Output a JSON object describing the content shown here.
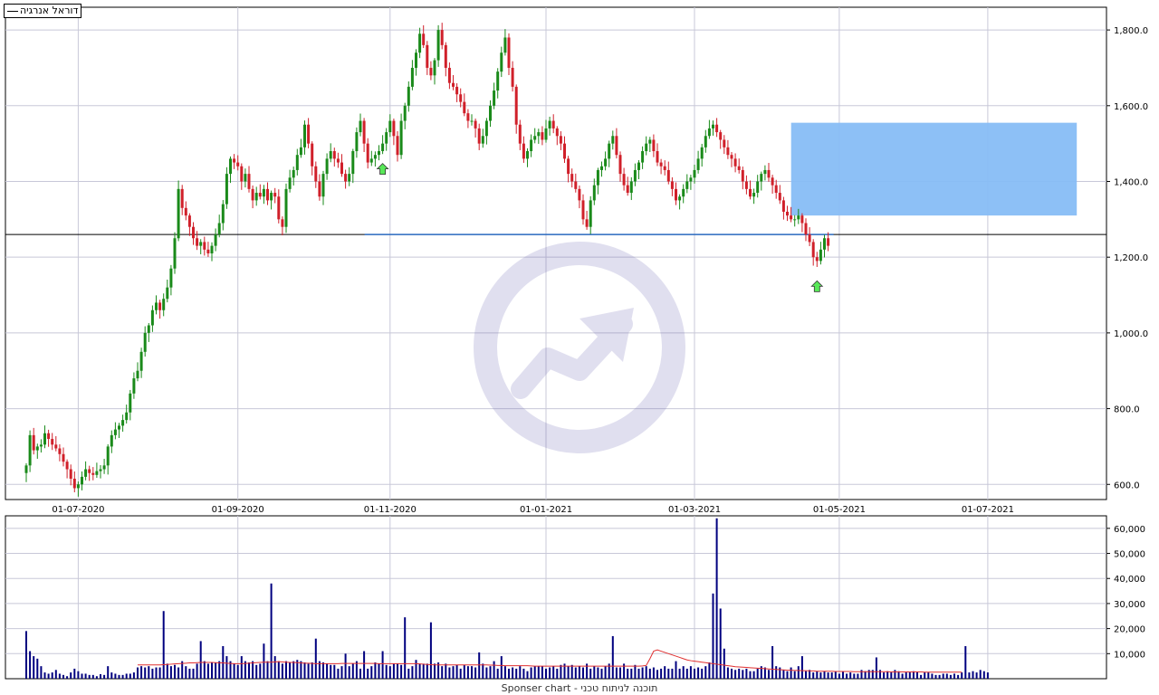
{
  "legend": {
    "label": "דוראל אנרגיה"
  },
  "footer": {
    "text": "Sponser chart - תוכנה לניתוח טכני"
  },
  "colors": {
    "up": "#1a8a1a",
    "down": "#d0202a",
    "zone": "#87bdf5",
    "support": "#2f6fc4",
    "volume": "#00007f",
    "volume_ma": "#e03030",
    "grid": "#c8c8d8"
  },
  "chart_data": [
    {
      "type": "candlestick",
      "ylim": [
        560,
        1860
      ],
      "yticks": [
        "600.0",
        "800.0",
        "1,000.0",
        "1,200.0",
        "1,400.0",
        "1,600.0",
        "1,800.0"
      ],
      "ytick_values": [
        600,
        800,
        1000,
        1200,
        1400,
        1600,
        1800
      ],
      "xticks": [
        "01-07-2020",
        "01-09-2020",
        "01-11-2020",
        "01-01-2021",
        "01-03-2021",
        "01-05-2021",
        "01-07-2021"
      ],
      "xtick_index": [
        14,
        57,
        98,
        140,
        180,
        219,
        259
      ],
      "close": [
        650,
        730,
        690,
        700,
        705,
        735,
        720,
        705,
        695,
        680,
        660,
        640,
        615,
        590,
        600,
        620,
        640,
        630,
        625,
        635,
        640,
        650,
        700,
        730,
        745,
        755,
        770,
        790,
        840,
        880,
        900,
        950,
        1000,
        1020,
        1060,
        1080,
        1060,
        1090,
        1120,
        1170,
        1250,
        1380,
        1330,
        1310,
        1280,
        1250,
        1230,
        1240,
        1220,
        1210,
        1230,
        1260,
        1290,
        1340,
        1420,
        1460,
        1450,
        1440,
        1400,
        1420,
        1380,
        1350,
        1370,
        1360,
        1380,
        1350,
        1370,
        1360,
        1300,
        1280,
        1380,
        1410,
        1430,
        1470,
        1490,
        1550,
        1500,
        1440,
        1400,
        1360,
        1420,
        1460,
        1480,
        1460,
        1450,
        1420,
        1400,
        1420,
        1480,
        1530,
        1560,
        1500,
        1450,
        1460,
        1470,
        1480,
        1500,
        1530,
        1560,
        1520,
        1470,
        1560,
        1600,
        1650,
        1700,
        1740,
        1790,
        1760,
        1700,
        1680,
        1720,
        1800,
        1760,
        1700,
        1660,
        1650,
        1630,
        1610,
        1580,
        1560,
        1560,
        1540,
        1500,
        1520,
        1560,
        1600,
        1640,
        1690,
        1740,
        1780,
        1700,
        1650,
        1550,
        1500,
        1460,
        1480,
        1510,
        1520,
        1530,
        1510,
        1540,
        1560,
        1540,
        1520,
        1500,
        1460,
        1420,
        1400,
        1380,
        1350,
        1300,
        1280,
        1350,
        1390,
        1430,
        1440,
        1460,
        1500,
        1520,
        1470,
        1420,
        1390,
        1370,
        1400,
        1430,
        1450,
        1480,
        1500,
        1510,
        1480,
        1450,
        1440,
        1430,
        1400,
        1380,
        1350,
        1360,
        1380,
        1400,
        1410,
        1430,
        1460,
        1490,
        1520,
        1540,
        1550,
        1530,
        1510,
        1490,
        1470,
        1460,
        1440,
        1430,
        1400,
        1380,
        1360,
        1370,
        1400,
        1420,
        1430,
        1410,
        1390,
        1370,
        1350,
        1320,
        1310,
        1300,
        1300,
        1310,
        1290,
        1260,
        1240,
        1200,
        1190,
        1220,
        1250,
        1230
      ],
      "volume_ylim": [
        0,
        65000
      ],
      "volume_yticks": [
        "10,000",
        "20,000",
        "30,000",
        "40,000",
        "50,000",
        "60,000"
      ],
      "volume_ytick_values": [
        10000,
        20000,
        30000,
        40000,
        50000,
        60000
      ],
      "volume": [
        19000,
        11000,
        9000,
        8000,
        5000,
        2500,
        2000,
        2500,
        3500,
        2000,
        1500,
        1000,
        2500,
        4000,
        3000,
        2000,
        2000,
        1500,
        1500,
        1000,
        1800,
        1500,
        5000,
        2500,
        2000,
        1500,
        1500,
        2000,
        2000,
        2500,
        4500,
        5000,
        4500,
        5000,
        4000,
        4500,
        4500,
        27000,
        6000,
        5000,
        5500,
        4500,
        7000,
        5000,
        4000,
        4000,
        6000,
        15000,
        7000,
        6000,
        6500,
        6500,
        7000,
        13000,
        9000,
        7000,
        6000,
        5500,
        9000,
        7000,
        6500,
        7000,
        5500,
        6000,
        14000,
        7000,
        38000,
        9000,
        7000,
        6000,
        7000,
        6500,
        7000,
        7500,
        7000,
        6500,
        6000,
        6500,
        16000,
        7000,
        6500,
        6000,
        5500,
        5500,
        4000,
        5000,
        10000,
        5000,
        6000,
        7000,
        4000,
        11000,
        4000,
        5000,
        6500,
        6000,
        11000,
        5500,
        5000,
        6000,
        6000,
        5500,
        24500,
        4000,
        5000,
        7500,
        6000,
        6000,
        6000,
        22500,
        6000,
        6500,
        5000,
        6000,
        4500,
        5000,
        5500,
        4000,
        5500,
        5000,
        5000,
        4500,
        10500,
        6000,
        4500,
        5000,
        7000,
        4000,
        9000,
        5000,
        4000,
        4500,
        4000,
        5000,
        4000,
        3000,
        4500,
        5000,
        5000,
        5000,
        4000,
        4500,
        5000,
        4000,
        5500,
        6000,
        5000,
        5500,
        4500,
        5000,
        4500,
        6000,
        4000,
        5000,
        4500,
        4000,
        5000,
        6000,
        17000,
        4500,
        4500,
        6000,
        4000,
        4000,
        5500,
        4000,
        4500,
        5000,
        4000,
        4500,
        3500,
        4000,
        5000,
        4000,
        4000,
        7000,
        4000,
        5000,
        4000,
        5000,
        4000,
        4500,
        4000,
        5000,
        6500,
        34000,
        64000,
        28000,
        12000,
        4500,
        4000,
        3500,
        4000,
        3500,
        4000,
        3000,
        3000,
        4000,
        5000,
        4500,
        3500,
        13000,
        5000,
        4500,
        3500,
        3000,
        4500,
        3000,
        5000,
        9000,
        3000,
        3500,
        2500,
        3000,
        2500,
        3000,
        2500,
        2500,
        3000,
        2000,
        3000,
        2000,
        2500,
        2000,
        2000,
        3500,
        3000,
        3500,
        3500,
        8500,
        3500,
        2500,
        3000,
        2500,
        3500,
        3000,
        2000,
        2500,
        2500,
        3000,
        2500,
        1500,
        2500,
        2500,
        2000,
        1500,
        1500,
        2000,
        2000,
        1500,
        2000,
        1500,
        2500,
        13000,
        2500,
        3000,
        2500,
        3500,
        3000,
        2500
      ],
      "volume_ma": [
        5500,
        5500,
        5500,
        5500,
        5500,
        5500,
        5500,
        5600,
        5700,
        5800,
        5900,
        6000,
        6100,
        6200,
        6300,
        6300,
        6400,
        6500,
        6500,
        6500,
        6500,
        6400,
        6300,
        6300,
        6200,
        6100,
        6000,
        6000,
        6000,
        6100,
        6200,
        6300,
        6400,
        6500,
        6600,
        6600,
        6600,
        6700,
        6800,
        6700,
        6600,
        6500,
        6500,
        6400,
        6300,
        6200,
        6200,
        6100,
        6000,
        6000,
        6000,
        6000,
        6000,
        6000,
        6000,
        6100,
        6100,
        6100,
        6100,
        6100,
        6100,
        6100,
        6100,
        6100,
        6100,
        6000,
        6000,
        6000,
        6000,
        6000,
        6000,
        6000,
        6000,
        6000,
        6000,
        6000,
        5900,
        5800,
        5700,
        5600,
        5500,
        5500,
        5500,
        5500,
        5500,
        5500,
        5500,
        5500,
        5500,
        5500,
        5500,
        5500,
        5500,
        5500,
        5500,
        5400,
        5400,
        5300,
        5300,
        5200,
        5200,
        5200,
        5200,
        5200,
        5200,
        5200,
        5100,
        5000,
        5000,
        5000,
        5000,
        5000,
        5000,
        5000,
        5000,
        5000,
        5000,
        5000,
        5000,
        5000,
        5000,
        5000,
        5000,
        5000,
        5000,
        5000,
        5000,
        5000,
        5000,
        5000,
        5000,
        5000,
        5000,
        5000,
        5000,
        5000,
        5100,
        5300,
        8000,
        11000,
        11500,
        11000,
        10500,
        10000,
        9500,
        9000,
        8500,
        8000,
        7500,
        7200,
        7000,
        6800,
        6600,
        6400,
        6200,
        6000,
        5800,
        5600,
        5400,
        5200,
        5000,
        4800,
        4700,
        4600,
        4500,
        4400,
        4300,
        4200,
        4100,
        4000,
        3900,
        3800,
        3700,
        3600,
        3500,
        3400,
        3400,
        3300,
        3300,
        3200,
        3200,
        3100,
        3100,
        3000,
        3000,
        3000,
        3000,
        3000,
        2900,
        2900,
        2900,
        2900,
        2900,
        2800,
        2800,
        2800,
        2800,
        2800,
        2800,
        2800,
        2800,
        2800,
        2800,
        2700,
        2700,
        2700,
        2700,
        2700,
        2700,
        2700,
        2700,
        2700,
        2600,
        2600,
        2600,
        2600,
        2600,
        2600,
        2600,
        2600,
        2600,
        2600,
        2600
      ],
      "volume_ma_start": 30,
      "support_level": 1260,
      "support_from": 96,
      "zone": {
        "from_index": 207,
        "to_index": 282,
        "low": 1310,
        "high": 1555
      },
      "markers": [
        {
          "index": 96,
          "dir": "up"
        },
        {
          "index": 213,
          "dir": "up"
        },
        {
          "index": 222,
          "dir": "down"
        },
        {
          "index": 226,
          "dir": "down"
        },
        {
          "index": 236,
          "dir": "down"
        },
        {
          "index": 247,
          "dir": "up"
        },
        {
          "index": 259,
          "dir": "down"
        },
        {
          "index": 271,
          "dir": "up"
        }
      ],
      "hline_level": 1260
    }
  ]
}
